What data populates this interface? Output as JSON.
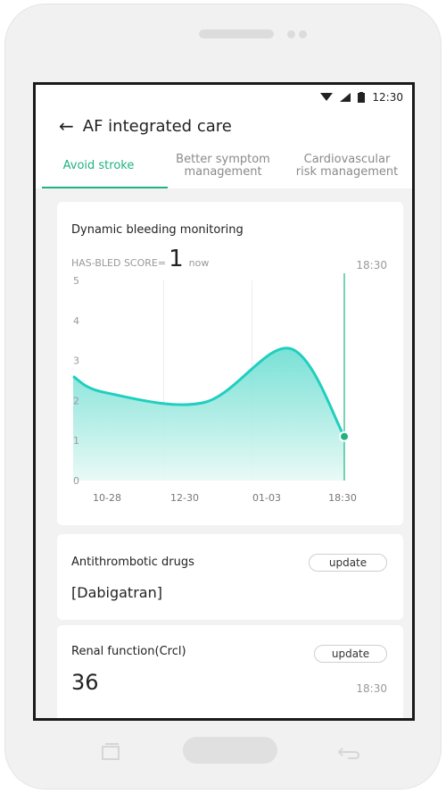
{
  "status": {
    "time": "12:30"
  },
  "header": {
    "title": "AF integrated care",
    "back_icon": "arrow-left-icon"
  },
  "tabs": [
    {
      "label": "Avoid stroke",
      "active": true
    },
    {
      "label": "Better symptom management",
      "active": false
    },
    {
      "label": "Cardiovascular risk management",
      "active": false
    }
  ],
  "bleeding_card": {
    "title": "Dynamic bleeding monitoring",
    "score_label": "HAS-BLED SCORE=",
    "score_value": "1",
    "score_when": "now",
    "time": "18:30"
  },
  "chart_data": {
    "type": "area",
    "categories": [
      "10-28",
      "12-30",
      "01-03",
      "18:30"
    ],
    "y_ticks": [
      "0",
      "1",
      "2",
      "3",
      "4",
      "5"
    ],
    "ylim": [
      0,
      5
    ],
    "points": [
      {
        "x": 0.0,
        "y": 2.6
      },
      {
        "x": 0.35,
        "y": 2.2
      },
      {
        "x": 1.45,
        "y": 1.95
      },
      {
        "x": 2.4,
        "y": 3.3
      },
      {
        "x": 3.0,
        "y": 1.1
      }
    ],
    "accent": "#1fcfbf",
    "marker_color": "#1fb37f"
  },
  "drugs_card": {
    "title": "Antithrombotic drugs",
    "value": "[Dabigatran]",
    "update_label": "update"
  },
  "renal_card": {
    "title": "Renal function(Crcl)",
    "value": "36",
    "time": "18:30",
    "update_label": "update"
  }
}
